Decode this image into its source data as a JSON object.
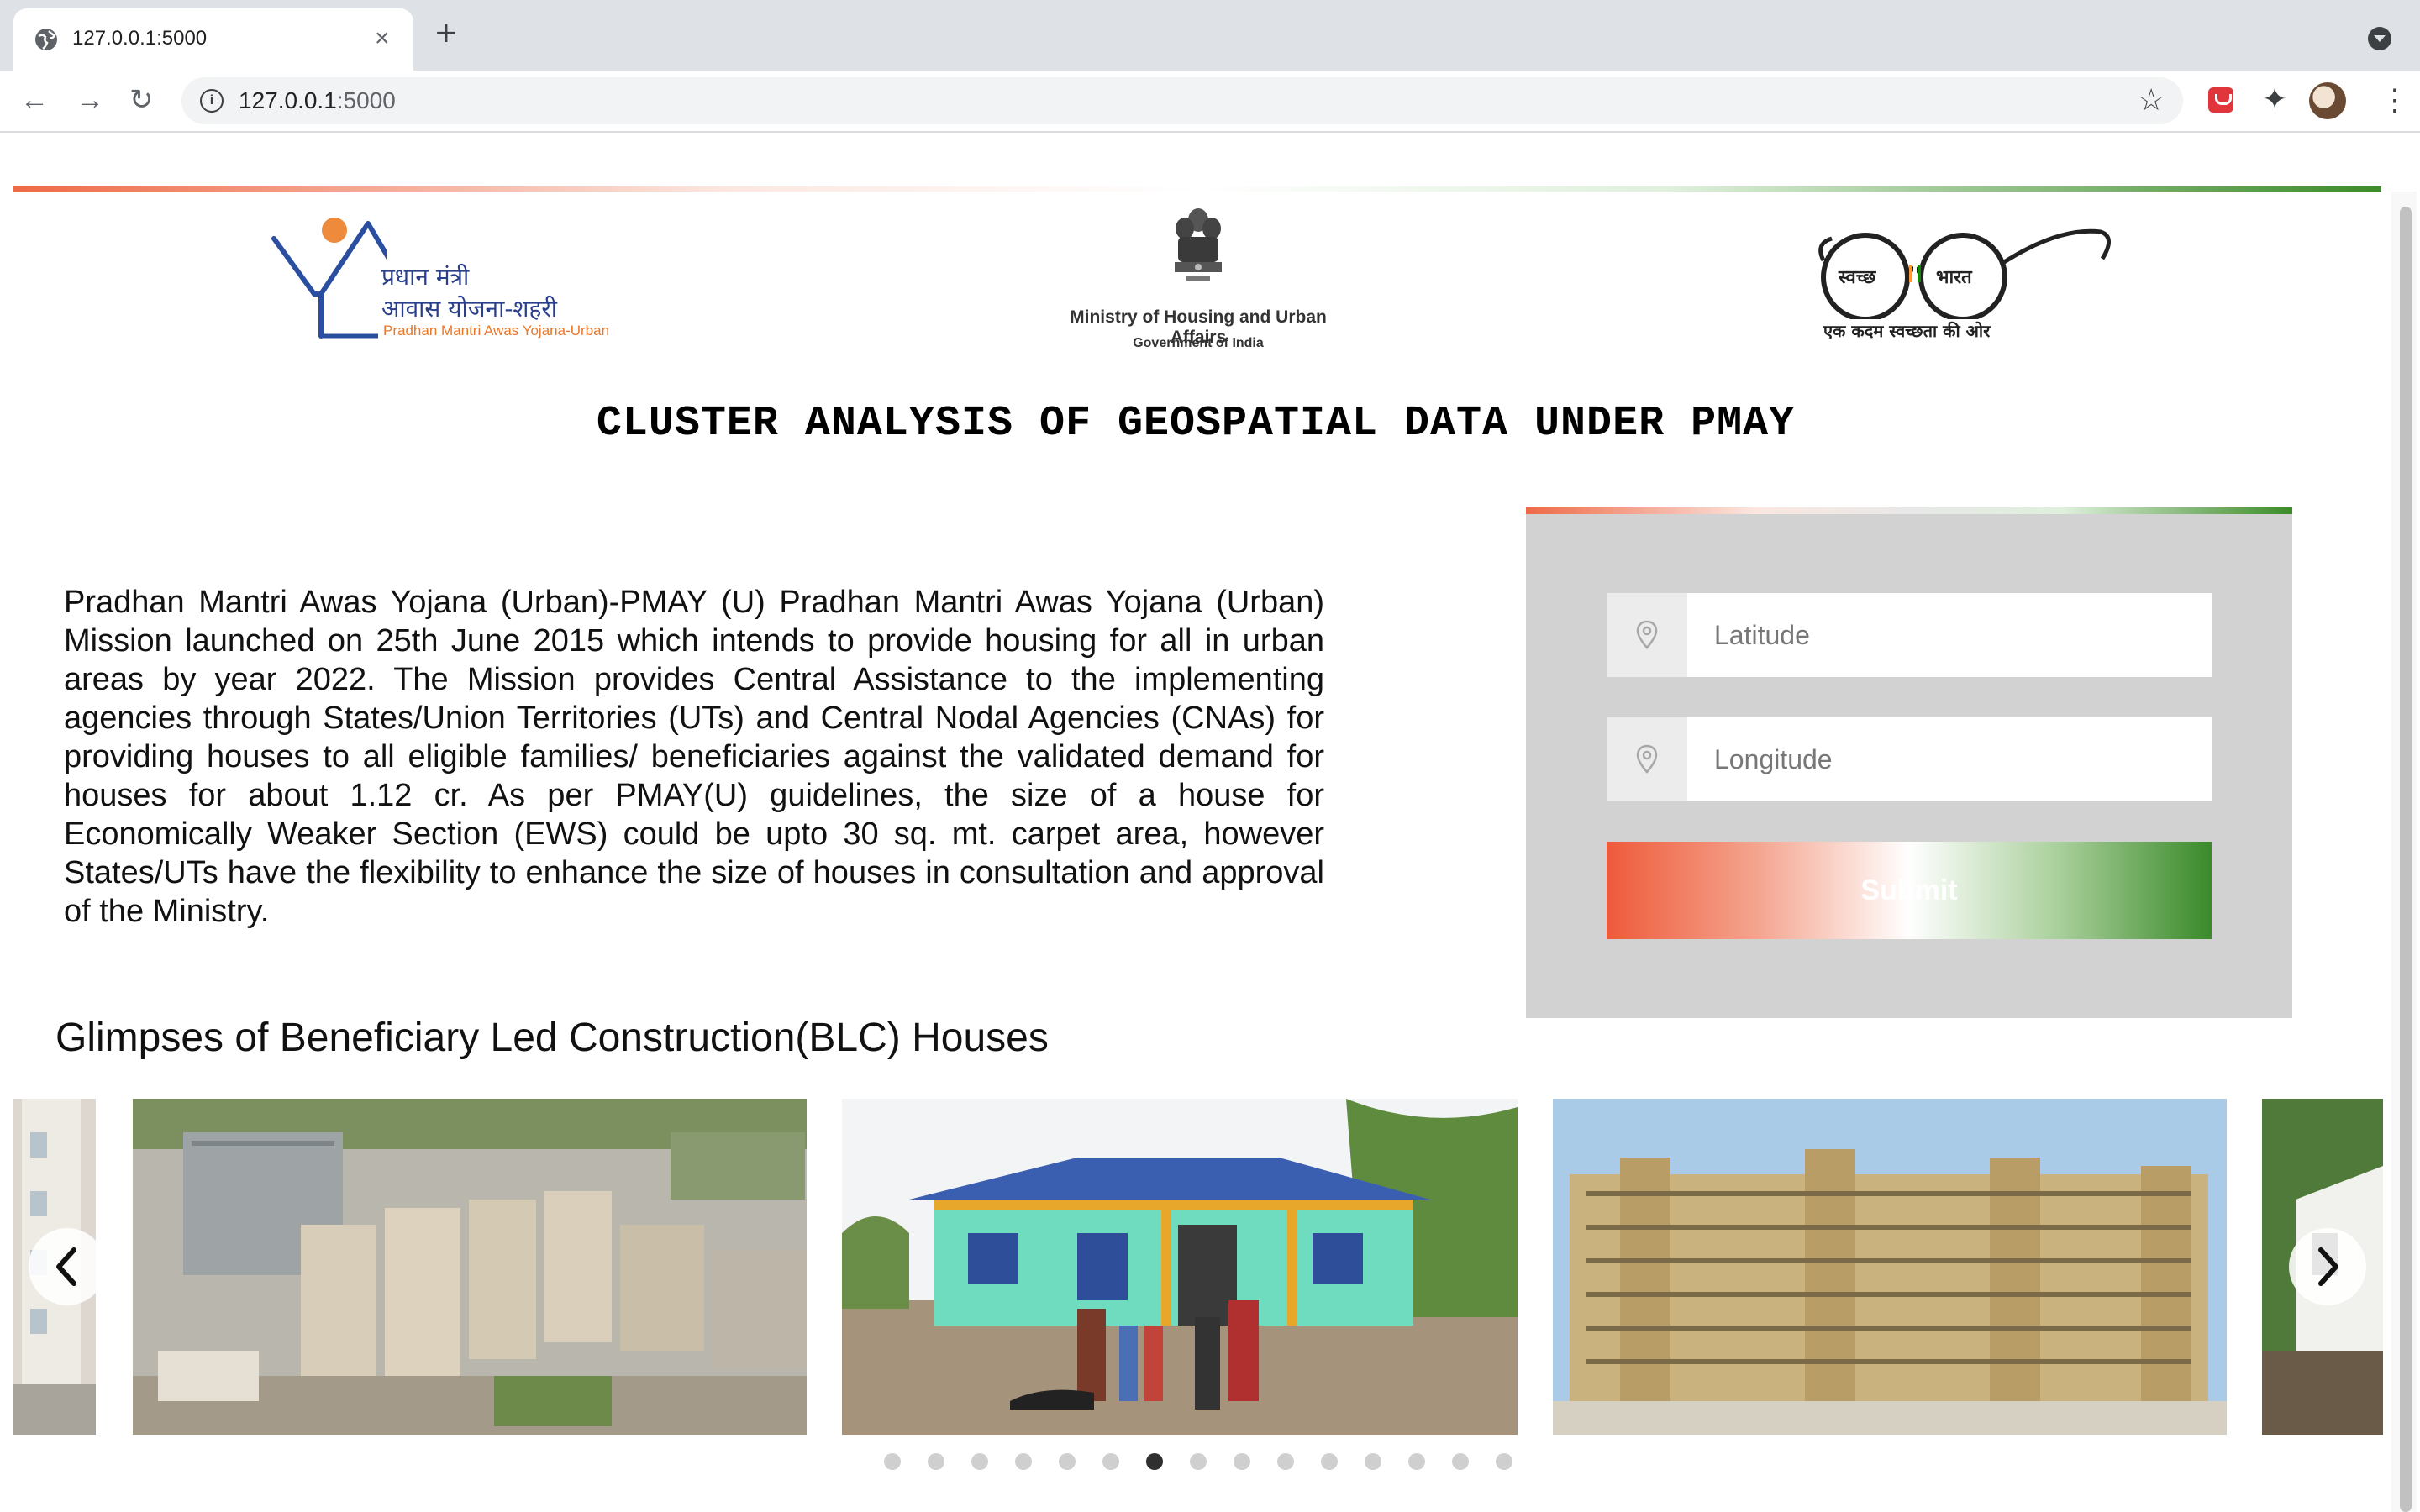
{
  "browser": {
    "tab_title": "127.0.0.1:5000",
    "tab_close": "×",
    "new_tab": "+",
    "url_host": "127.0.0.1",
    "url_port": ":5000",
    "back": "←",
    "forward": "→",
    "reload": "↻",
    "bookmark": "☆",
    "extensions": "✦",
    "menu": "⋮",
    "info_glyph": "i"
  },
  "header": {
    "pmay_logo": {
      "line1": "प्रधान मंत्री",
      "line2": "आवास योजना-शहरी",
      "english": "Pradhan Mantri Awas Yojana-Urban"
    },
    "ministry_logo": {
      "line1": "Ministry of Housing and Urban Affairs",
      "line2": "Government of India"
    },
    "swachh_logo": {
      "word1": "स्वच्छ",
      "word2": "भारत",
      "tagline": "एक कदम स्वच्छता की ओर"
    }
  },
  "main": {
    "title": "CLUSTER ANALYSIS OF GEOSPATIAL DATA UNDER PMAY",
    "intro": "Pradhan Mantri Awas Yojana (Urban)-PMAY (U) Pradhan Mantri Awas Yojana (Urban) Mission launched on 25th June 2015 which intends to provide housing for all in urban areas by year 2022. The Mission provides Central Assistance to the implementing agencies through States/Union Territories (UTs) and Central Nodal Agencies (CNAs) for providing houses to all eligible families/ beneficiaries against the validated demand for houses for about 1.12 cr. As per PMAY(U) guidelines, the size of a house for Economically Weaker Section (EWS) could be upto 30 sq. mt. carpet area, however States/UTs have the flexibility to enhance the size of houses in consultation and approval of the Ministry."
  },
  "form": {
    "latitude_placeholder": "Latitude",
    "longitude_placeholder": "Longitude",
    "submit_label": "Submit"
  },
  "gallery": {
    "heading": "Glimpses of Beneficiary Led Construction(BLC) Houses",
    "dot_count": 15,
    "active_dot": 7
  },
  "colors": {
    "saffron": "#ee6a47",
    "green": "#3c8b29",
    "panel": "#d2d2d2"
  }
}
